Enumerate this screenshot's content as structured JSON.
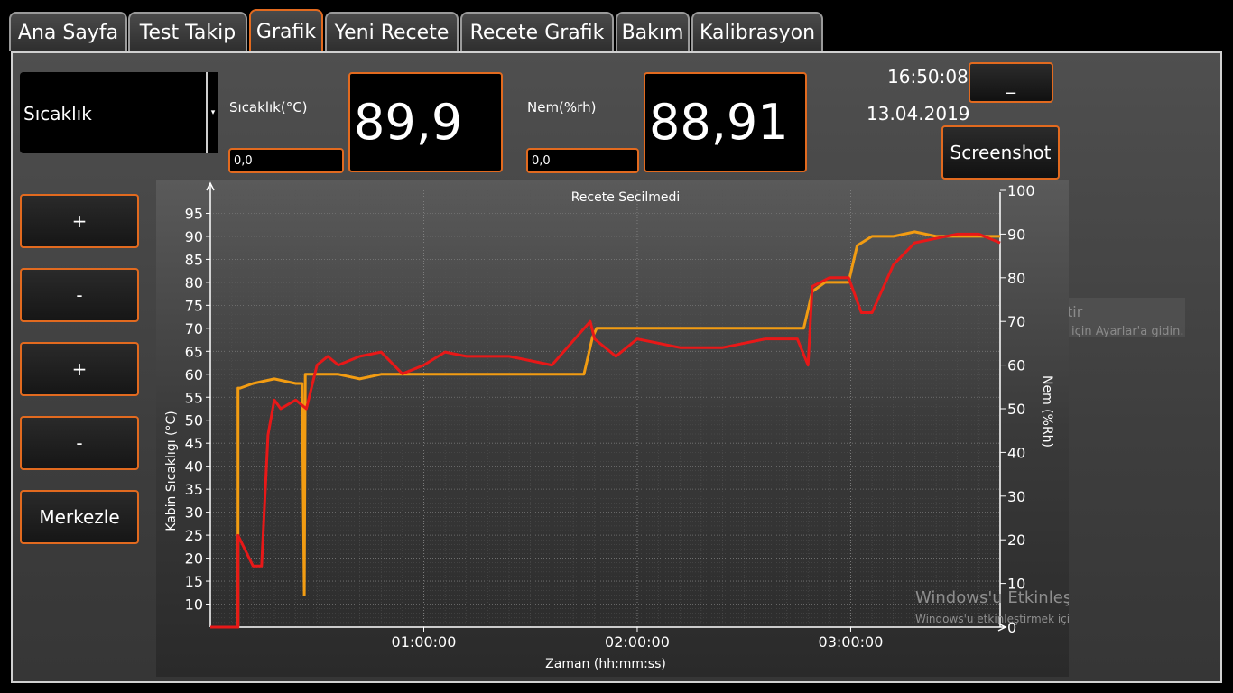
{
  "tabs": [
    "Ana Sayfa",
    "Test Takip",
    "Grafik",
    "Yeni Recete",
    "Recete Grafik",
    "Bakım",
    "Kalibrasyon"
  ],
  "combo": {
    "value": "Sıcaklık",
    "arrow": "▾"
  },
  "temp": {
    "label": "Sıcaklık(°C)",
    "setpoint": "0,0",
    "value": "89,9"
  },
  "hum": {
    "label": "Nem(%rh)",
    "setpoint": "0,0",
    "value": "88,91"
  },
  "clock": {
    "time": "16:50:08",
    "date": "13.04.2019"
  },
  "buttons": {
    "minimize": "_",
    "screenshot": "Screenshot"
  },
  "side_buttons": [
    "+",
    "-",
    "+",
    "-",
    "Merkezle"
  ],
  "watermark": {
    "title": "Windows'u Etkinleştir",
    "subtitle": "Windows'u etkinleştirmek için Ayarlar'a gidin.",
    "partial_title": "tir",
    "partial_subtitle": "için Ayarlar'a gidin."
  },
  "colors": {
    "accent": "#e26a1f",
    "temperature_series": "#f29c12",
    "humidity_series": "#e81818"
  },
  "chart_data": {
    "type": "line",
    "title": "Recete Secilmedi",
    "xlabel": "Zaman (hh:mm:ss)",
    "ylabel": "Kabin Sıcaklıgı (°C)",
    "y2label": "Nem (%Rh)",
    "xlim": [
      0,
      3.7
    ],
    "ylim": [
      5,
      100
    ],
    "y2lim": [
      0,
      100
    ],
    "x_ticks": [
      1,
      2,
      3
    ],
    "x_tick_labels": [
      "01:00:00",
      "02:00:00",
      "03:00:00"
    ],
    "y_ticks": [
      10,
      15,
      20,
      25,
      30,
      35,
      40,
      45,
      50,
      55,
      60,
      65,
      70,
      75,
      80,
      85,
      90,
      95
    ],
    "y2_ticks": [
      0,
      10,
      20,
      30,
      40,
      50,
      60,
      70,
      80,
      90,
      100
    ],
    "grid": true,
    "series": [
      {
        "axis": "left",
        "color": "#f29c12",
        "x": [
          0,
          0.13,
          0.13,
          0.14,
          0.2,
          0.3,
          0.4,
          0.43,
          0.44,
          0.445,
          0.46,
          0.6,
          0.7,
          0.8,
          0.9,
          1.0,
          1.2,
          1.4,
          1.6,
          1.75,
          1.79,
          1.81,
          1.9,
          2.0,
          2.2,
          2.4,
          2.6,
          2.75,
          2.78,
          2.82,
          2.88,
          2.99,
          3.03,
          3.1,
          3.2,
          3.3,
          3.4,
          3.5,
          3.6,
          3.7
        ],
        "y": [
          5,
          5,
          57,
          57,
          58,
          59,
          58,
          58,
          12,
          60,
          60,
          60,
          59,
          60,
          60,
          60,
          60,
          60,
          60,
          60,
          68,
          70,
          70,
          70,
          70,
          70,
          70,
          70,
          70,
          78,
          80,
          80,
          88,
          90,
          90,
          91,
          90,
          90,
          90,
          90
        ]
      },
      {
        "axis": "right",
        "color": "#e81818",
        "x": [
          0,
          0.13,
          0.13,
          0.2,
          0.24,
          0.27,
          0.3,
          0.33,
          0.4,
          0.45,
          0.5,
          0.55,
          0.6,
          0.7,
          0.8,
          0.9,
          1.0,
          1.1,
          1.2,
          1.4,
          1.6,
          1.78,
          1.8,
          1.9,
          2.0,
          2.2,
          2.4,
          2.6,
          2.75,
          2.8,
          2.82,
          2.9,
          2.99,
          3.05,
          3.1,
          3.2,
          3.3,
          3.4,
          3.5,
          3.6,
          3.7
        ],
        "y": [
          0,
          0,
          21,
          14,
          14,
          44,
          52,
          50,
          52,
          50,
          60,
          62,
          60,
          62,
          63,
          58,
          60,
          63,
          62,
          62,
          60,
          70,
          66,
          62,
          66,
          64,
          64,
          66,
          66,
          60,
          78,
          80,
          80,
          72,
          72,
          83,
          88,
          89,
          90,
          90,
          88
        ]
      }
    ]
  }
}
